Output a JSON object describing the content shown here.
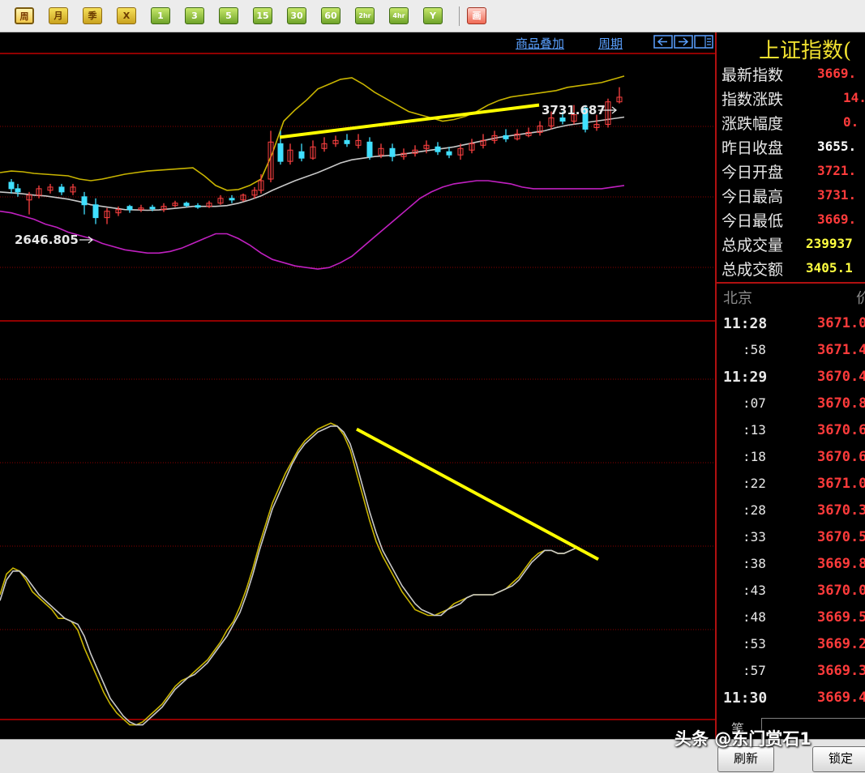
{
  "toolbar": {
    "buttons": [
      {
        "label": "周",
        "style": "active"
      },
      {
        "label": "月",
        "style": "gold"
      },
      {
        "label": "季",
        "style": "gold"
      },
      {
        "label": "X",
        "style": "gold"
      },
      {
        "label": "1",
        "style": "green"
      },
      {
        "label": "3",
        "style": "green"
      },
      {
        "label": "5",
        "style": "green"
      },
      {
        "label": "15",
        "style": "green"
      },
      {
        "label": "30",
        "style": "green"
      },
      {
        "label": "60",
        "style": "green"
      },
      {
        "label": "2hr",
        "style": "green"
      },
      {
        "label": "4hr",
        "style": "green"
      },
      {
        "label": "Y",
        "style": "green"
      },
      {
        "label": "画",
        "style": "red"
      }
    ]
  },
  "chart_header": {
    "overlay_link": "商品叠加",
    "period_link": "周期",
    "nav_icons": [
      "arrow-left-icon",
      "arrow-right-icon",
      "panel-toggle-icon"
    ]
  },
  "annotations": {
    "high_label": "3731.687",
    "low_label": "2646.805"
  },
  "colors": {
    "up": "#FF4040",
    "down": "#40E0FF",
    "boll_upper_lower_mid": [
      "#C8B400",
      "#C020C0",
      "#C8C8C8"
    ],
    "trendline": "#FFFF00",
    "grid": "#8B0000",
    "frame": "#C00000"
  },
  "chart_data": {
    "type": "line",
    "title": "",
    "price_panel": {
      "ylim": [
        2500,
        3850
      ],
      "x": [
        0,
        14,
        28,
        42,
        56,
        70,
        84,
        98,
        112,
        126,
        140,
        154,
        168,
        182,
        196,
        210,
        224,
        238,
        252,
        266,
        280,
        294,
        308,
        322,
        336,
        350,
        364,
        378,
        392,
        406,
        420,
        434,
        448,
        462,
        476,
        490,
        504,
        518,
        532,
        546,
        560,
        574,
        588,
        602,
        616,
        630,
        644,
        658,
        672,
        686,
        700,
        714,
        728,
        742,
        756,
        770
      ],
      "series": [
        {
          "name": "upper",
          "values": [
            3200,
            3210,
            3205,
            3195,
            3190,
            3185,
            3180,
            3160,
            3150,
            3160,
            3175,
            3190,
            3200,
            3210,
            3215,
            3220,
            3225,
            3230,
            3180,
            3120,
            3090,
            3095,
            3120,
            3160,
            3320,
            3520,
            3590,
            3650,
            3720,
            3750,
            3780,
            3790,
            3750,
            3700,
            3660,
            3620,
            3580,
            3560,
            3540,
            3520,
            3530,
            3550,
            3580,
            3620,
            3650,
            3670,
            3680,
            3690,
            3700,
            3710,
            3730,
            3740,
            3750,
            3760,
            3780,
            3800
          ]
        },
        {
          "name": "lower",
          "values": [
            2960,
            2950,
            2930,
            2910,
            2880,
            2860,
            2830,
            2810,
            2790,
            2760,
            2740,
            2720,
            2710,
            2700,
            2700,
            2710,
            2730,
            2760,
            2790,
            2820,
            2820,
            2790,
            2750,
            2700,
            2660,
            2640,
            2620,
            2610,
            2600,
            2610,
            2640,
            2680,
            2740,
            2800,
            2860,
            2920,
            2980,
            3040,
            3080,
            3110,
            3130,
            3140,
            3150,
            3150,
            3140,
            3130,
            3110,
            3100,
            3100,
            3100,
            3100,
            3100,
            3100,
            3100,
            3110,
            3120
          ]
        },
        {
          "name": "mid",
          "values": [
            3080,
            3075,
            3068,
            3060,
            3055,
            3045,
            3035,
            3020,
            3000,
            2990,
            2980,
            2970,
            2968,
            2966,
            2968,
            2975,
            2982,
            2990,
            2990,
            2990,
            2995,
            3010,
            3030,
            3055,
            3090,
            3120,
            3150,
            3175,
            3200,
            3230,
            3260,
            3280,
            3290,
            3300,
            3305,
            3310,
            3320,
            3330,
            3340,
            3350,
            3360,
            3375,
            3390,
            3405,
            3420,
            3430,
            3440,
            3450,
            3460,
            3480,
            3495,
            3505,
            3515,
            3525,
            3535,
            3545
          ]
        }
      ],
      "candles": [
        {
          "x": 14,
          "o": 3140,
          "c": 3100,
          "h": 3160,
          "l": 3070
        },
        {
          "x": 22,
          "o": 3100,
          "c": 3080,
          "h": 3130,
          "l": 3050
        },
        {
          "x": 36,
          "o": 3030,
          "c": 3060,
          "h": 3080,
          "l": 2940
        },
        {
          "x": 48,
          "o": 3060,
          "c": 3100,
          "h": 3120,
          "l": 3040
        },
        {
          "x": 62,
          "o": 3090,
          "c": 3110,
          "h": 3130,
          "l": 3070
        },
        {
          "x": 76,
          "o": 3110,
          "c": 3080,
          "h": 3130,
          "l": 3060
        },
        {
          "x": 90,
          "o": 3080,
          "c": 3110,
          "h": 3130,
          "l": 3060
        },
        {
          "x": 104,
          "o": 3050,
          "c": 3000,
          "h": 3080,
          "l": 2940
        },
        {
          "x": 118,
          "o": 3000,
          "c": 2920,
          "h": 3040,
          "l": 2880
        },
        {
          "x": 132,
          "o": 2920,
          "c": 2960,
          "h": 2980,
          "l": 2880
        },
        {
          "x": 146,
          "o": 2950,
          "c": 2970,
          "h": 2990,
          "l": 2930
        },
        {
          "x": 160,
          "o": 2990,
          "c": 2970,
          "h": 3000,
          "l": 2950
        },
        {
          "x": 174,
          "o": 2970,
          "c": 2980,
          "h": 3000,
          "l": 2955
        },
        {
          "x": 188,
          "o": 2985,
          "c": 2975,
          "h": 3000,
          "l": 2960
        },
        {
          "x": 202,
          "o": 2970,
          "c": 2990,
          "h": 3010,
          "l": 2955
        },
        {
          "x": 216,
          "o": 2995,
          "c": 3010,
          "h": 3025,
          "l": 2985
        },
        {
          "x": 230,
          "o": 3010,
          "c": 2995,
          "h": 3020,
          "l": 2985
        },
        {
          "x": 244,
          "o": 2995,
          "c": 2985,
          "h": 3010,
          "l": 2975
        },
        {
          "x": 258,
          "o": 2990,
          "c": 3010,
          "h": 3025,
          "l": 2980
        },
        {
          "x": 272,
          "o": 3010,
          "c": 3040,
          "h": 3060,
          "l": 3000
        },
        {
          "x": 286,
          "o": 3040,
          "c": 3030,
          "h": 3060,
          "l": 3010
        },
        {
          "x": 300,
          "o": 3030,
          "c": 3060,
          "h": 3070,
          "l": 3020
        },
        {
          "x": 314,
          "o": 3060,
          "c": 3090,
          "h": 3110,
          "l": 3040
        },
        {
          "x": 322,
          "o": 3090,
          "c": 3150,
          "h": 3190,
          "l": 3070
        },
        {
          "x": 334,
          "o": 3160,
          "c": 3390,
          "h": 3460,
          "l": 3140
        },
        {
          "x": 346,
          "o": 3380,
          "c": 3270,
          "h": 3460,
          "l": 3250
        },
        {
          "x": 358,
          "o": 3270,
          "c": 3340,
          "h": 3380,
          "l": 3250
        },
        {
          "x": 372,
          "o": 3330,
          "c": 3290,
          "h": 3380,
          "l": 3270
        },
        {
          "x": 386,
          "o": 3290,
          "c": 3360,
          "h": 3400,
          "l": 3280
        },
        {
          "x": 400,
          "o": 3350,
          "c": 3380,
          "h": 3420,
          "l": 3330
        },
        {
          "x": 414,
          "o": 3380,
          "c": 3400,
          "h": 3430,
          "l": 3360
        },
        {
          "x": 428,
          "o": 3400,
          "c": 3380,
          "h": 3440,
          "l": 3360
        },
        {
          "x": 442,
          "o": 3370,
          "c": 3400,
          "h": 3440,
          "l": 3350
        },
        {
          "x": 456,
          "o": 3390,
          "c": 3300,
          "h": 3420,
          "l": 3280
        },
        {
          "x": 470,
          "o": 3310,
          "c": 3350,
          "h": 3380,
          "l": 3290
        },
        {
          "x": 484,
          "o": 3350,
          "c": 3300,
          "h": 3380,
          "l": 3270
        },
        {
          "x": 498,
          "o": 3300,
          "c": 3320,
          "h": 3350,
          "l": 3280
        },
        {
          "x": 512,
          "o": 3320,
          "c": 3340,
          "h": 3370,
          "l": 3300
        },
        {
          "x": 526,
          "o": 3350,
          "c": 3370,
          "h": 3400,
          "l": 3320
        },
        {
          "x": 540,
          "o": 3360,
          "c": 3330,
          "h": 3390,
          "l": 3310
        },
        {
          "x": 554,
          "o": 3330,
          "c": 3310,
          "h": 3360,
          "l": 3290
        },
        {
          "x": 568,
          "o": 3310,
          "c": 3350,
          "h": 3380,
          "l": 3280
        },
        {
          "x": 582,
          "o": 3340,
          "c": 3380,
          "h": 3410,
          "l": 3320
        },
        {
          "x": 596,
          "o": 3370,
          "c": 3400,
          "h": 3440,
          "l": 3350
        },
        {
          "x": 610,
          "o": 3400,
          "c": 3430,
          "h": 3460,
          "l": 3380
        },
        {
          "x": 624,
          "o": 3430,
          "c": 3410,
          "h": 3470,
          "l": 3390
        },
        {
          "x": 638,
          "o": 3410,
          "c": 3440,
          "h": 3470,
          "l": 3400
        },
        {
          "x": 652,
          "o": 3430,
          "c": 3450,
          "h": 3480,
          "l": 3420
        },
        {
          "x": 666,
          "o": 3450,
          "c": 3490,
          "h": 3520,
          "l": 3430
        },
        {
          "x": 680,
          "o": 3490,
          "c": 3540,
          "h": 3580,
          "l": 3470
        },
        {
          "x": 694,
          "o": 3540,
          "c": 3520,
          "h": 3580,
          "l": 3500
        },
        {
          "x": 708,
          "o": 3520,
          "c": 3560,
          "h": 3620,
          "l": 3500
        },
        {
          "x": 722,
          "o": 3600,
          "c": 3470,
          "h": 3620,
          "l": 3450
        },
        {
          "x": 736,
          "o": 3480,
          "c": 3500,
          "h": 3560,
          "l": 3460
        },
        {
          "x": 750,
          "o": 3500,
          "c": 3640,
          "h": 3660,
          "l": 3480
        },
        {
          "x": 764,
          "o": 3640,
          "c": 3669,
          "h": 3731,
          "l": 3630
        }
      ],
      "trendline": {
        "x": [
          345,
          665
        ],
        "y": [
          3420,
          3620
        ]
      }
    },
    "oscillator_panel": {
      "ylim": [
        0,
        100
      ],
      "x": [
        0,
        8,
        16,
        24,
        32,
        40,
        48,
        56,
        64,
        72,
        80,
        88,
        96,
        104,
        112,
        120,
        128,
        136,
        144,
        152,
        160,
        168,
        176,
        184,
        192,
        200,
        208,
        216,
        224,
        232,
        240,
        248,
        256,
        264,
        272,
        280,
        288,
        296,
        304,
        312,
        320,
        328,
        336,
        344,
        352,
        360,
        368,
        376,
        384,
        392,
        400,
        408,
        416,
        424,
        432,
        440,
        448,
        456,
        464,
        472,
        480,
        488,
        496,
        504,
        512,
        520,
        528,
        536,
        544,
        552,
        560,
        568,
        576,
        584,
        592,
        600,
        608,
        616,
        624,
        632,
        640,
        648,
        656,
        664,
        672,
        680,
        688,
        696,
        704,
        712,
        720,
        728,
        736,
        744,
        752,
        760,
        766
      ],
      "series": [
        {
          "name": "K",
          "values": [
            40,
            47,
            49,
            48,
            45,
            41,
            39,
            37,
            35,
            32,
            32,
            31,
            28,
            22,
            17,
            12,
            7,
            3,
            0,
            -2,
            -4,
            -4,
            -3,
            -1,
            1,
            3,
            6,
            9,
            11,
            12,
            14,
            16,
            18,
            21,
            24,
            28,
            31,
            36,
            42,
            49,
            57,
            64,
            71,
            76,
            81,
            85,
            89,
            92,
            94,
            96,
            97,
            98,
            97,
            94,
            89,
            81,
            73,
            65,
            58,
            53,
            49,
            45,
            41,
            38,
            35,
            34,
            33,
            33,
            34,
            35,
            37,
            38,
            39,
            40,
            40,
            40,
            40,
            41,
            42,
            44,
            46,
            49,
            52,
            54,
            55,
            55,
            54,
            54,
            55,
            56
          ]
        },
        {
          "name": "D",
          "values": [
            38,
            45,
            48,
            48,
            46,
            43,
            40,
            38,
            36,
            34,
            32,
            31,
            30,
            26,
            20,
            15,
            10,
            5,
            2,
            -1,
            -3,
            -4,
            -4,
            -2,
            0,
            2,
            5,
            8,
            10,
            12,
            13,
            15,
            17,
            20,
            23,
            26,
            30,
            34,
            40,
            47,
            55,
            62,
            69,
            74,
            79,
            84,
            88,
            91,
            93,
            95,
            96,
            97,
            97,
            95,
            91,
            84,
            76,
            68,
            61,
            55,
            51,
            47,
            43,
            40,
            37,
            35,
            34,
            33,
            33,
            35,
            36,
            37,
            39,
            40,
            40,
            40,
            40,
            41,
            42,
            43,
            45,
            48,
            51,
            53,
            55,
            55,
            54,
            54,
            55,
            56
          ]
        }
      ],
      "trendline": {
        "x": [
          440,
          738
        ],
        "y": [
          96,
          52
        ]
      }
    }
  },
  "panel": {
    "title": "上证指数(",
    "stats": [
      {
        "label": "最新指数",
        "value": "3669.",
        "color": "#FF3B3B"
      },
      {
        "label": "指数涨跌",
        "value": "14.",
        "color": "#FF3B3B"
      },
      {
        "label": "涨跌幅度",
        "value": "0.",
        "color": "#FF3B3B"
      },
      {
        "label": "昨日收盘",
        "value": "3655.",
        "color": "#FFFFFF"
      },
      {
        "label": "今日开盘",
        "value": "3721.",
        "color": "#FF3B3B"
      },
      {
        "label": "今日最高",
        "value": "3731.",
        "color": "#FF3B3B"
      },
      {
        "label": "今日最低",
        "value": "3669.",
        "color": "#FF3B3B"
      },
      {
        "label": "总成交量",
        "value": "239937",
        "color": "#FFFF40"
      },
      {
        "label": "总成交额",
        "value": "3405.1",
        "color": "#FFFF40"
      }
    ],
    "tick_header_left": "北京",
    "tick_header_right": "价",
    "ticks": [
      {
        "time": "11:28",
        "price": "3671.0",
        "major": true
      },
      {
        "time": ":58",
        "price": "3671.4",
        "major": false
      },
      {
        "time": "11:29",
        "price": "3670.4",
        "major": true
      },
      {
        "time": ":07",
        "price": "3670.8",
        "major": false
      },
      {
        "time": ":13",
        "price": "3670.6",
        "major": false
      },
      {
        "time": ":18",
        "price": "3670.6",
        "major": false
      },
      {
        "time": ":22",
        "price": "3671.0",
        "major": false
      },
      {
        "time": ":28",
        "price": "3670.3",
        "major": false
      },
      {
        "time": ":33",
        "price": "3670.5",
        "major": false
      },
      {
        "time": ":38",
        "price": "3669.8",
        "major": false
      },
      {
        "time": ":43",
        "price": "3670.0",
        "major": false
      },
      {
        "time": ":48",
        "price": "3669.5",
        "major": false
      },
      {
        "time": ":53",
        "price": "3669.2",
        "major": false
      },
      {
        "time": ":57",
        "price": "3669.3",
        "major": false
      },
      {
        "time": "11:30",
        "price": "3669.4",
        "major": true
      }
    ],
    "footer_label": "笔"
  },
  "bottom_bar": {
    "refresh_label": "刷新",
    "lock_label": "锁定"
  },
  "watermark": "头条 @东门赏石1"
}
